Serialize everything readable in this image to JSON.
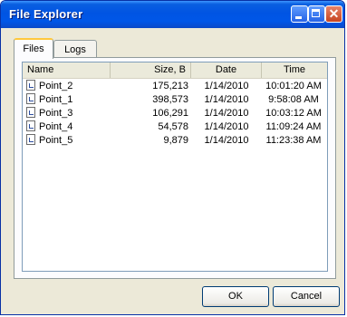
{
  "window": {
    "title": "File Explorer"
  },
  "tabs": [
    {
      "label": "Files",
      "active": true
    },
    {
      "label": "Logs",
      "active": false
    }
  ],
  "columns": [
    "Name",
    "Size, B",
    "Date",
    "Time"
  ],
  "files": [
    {
      "name": "Point_2",
      "size": "175,213",
      "date": "1/14/2010",
      "time": "10:01:20 AM"
    },
    {
      "name": "Point_1",
      "size": "398,573",
      "date": "1/14/2010",
      "time": "9:58:08 AM"
    },
    {
      "name": "Point_3",
      "size": "106,291",
      "date": "1/14/2010",
      "time": "10:03:12 AM"
    },
    {
      "name": "Point_4",
      "size": "54,578",
      "date": "1/14/2010",
      "time": "11:09:24 AM"
    },
    {
      "name": "Point_5",
      "size": "9,879",
      "date": "1/14/2010",
      "time": "11:23:38 AM"
    }
  ],
  "buttons": {
    "ok": "OK",
    "cancel": "Cancel"
  },
  "colors": {
    "titlebar": "#0054e3",
    "frame": "#ece9d8",
    "close": "#c64420"
  }
}
